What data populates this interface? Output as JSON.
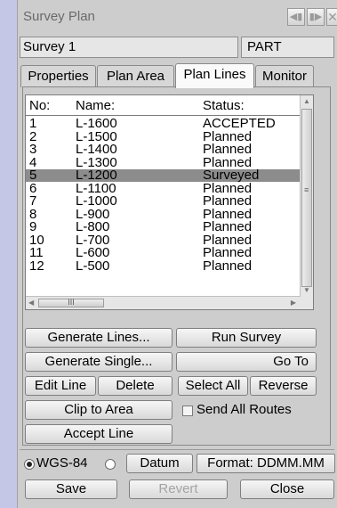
{
  "window": {
    "title": "Survey Plan",
    "buttons": [
      "first-icon",
      "last-icon",
      "close-icon"
    ]
  },
  "survey": {
    "name": "Survey 1",
    "mode": "PART"
  },
  "tabs": [
    {
      "label": "Properties",
      "active": false
    },
    {
      "label": "Plan Area",
      "active": false
    },
    {
      "label": "Plan Lines",
      "active": true
    },
    {
      "label": "Monitor",
      "active": false
    }
  ],
  "table": {
    "columns": [
      "No:",
      "Name:",
      "Status:"
    ],
    "rows": [
      {
        "no": "1",
        "name": "L-1600",
        "status": "ACCEPTED"
      },
      {
        "no": "2",
        "name": "L-1500",
        "status": "Planned"
      },
      {
        "no": "3",
        "name": "L-1400",
        "status": "Planned"
      },
      {
        "no": "4",
        "name": "L-1300",
        "status": "Planned"
      },
      {
        "no": "5",
        "name": "L-1200",
        "status": "Surveyed",
        "selected": true
      },
      {
        "no": "6",
        "name": "L-1100",
        "status": "Planned"
      },
      {
        "no": "7",
        "name": "L-1000",
        "status": "Planned"
      },
      {
        "no": "8",
        "name": "L-900",
        "status": "Planned"
      },
      {
        "no": "9",
        "name": "L-800",
        "status": "Planned"
      },
      {
        "no": "10",
        "name": "L-700",
        "status": "Planned"
      },
      {
        "no": "11",
        "name": "L-600",
        "status": "Planned"
      },
      {
        "no": "12",
        "name": "L-500",
        "status": "Planned"
      }
    ],
    "hscroll_thumb_label": "III"
  },
  "actions": {
    "generate_lines": "Generate Lines...",
    "run_survey": "Run Survey",
    "generate_single": "Generate Single...",
    "go_to": "Go To",
    "edit_line": "Edit Line",
    "delete": "Delete",
    "select_all": "Select All",
    "reverse": "Reverse",
    "clip_to_area": "Clip to Area",
    "send_all_routes": "Send All Routes",
    "accept_line": "Accept Line"
  },
  "datum": {
    "wgs84_label": "WGS-84",
    "wgs84_selected": true,
    "other_selected": false,
    "datum_button": "Datum",
    "format_label": "Format: DDMM.MM"
  },
  "footer": {
    "save": "Save",
    "revert": "Revert",
    "close": "Close"
  }
}
